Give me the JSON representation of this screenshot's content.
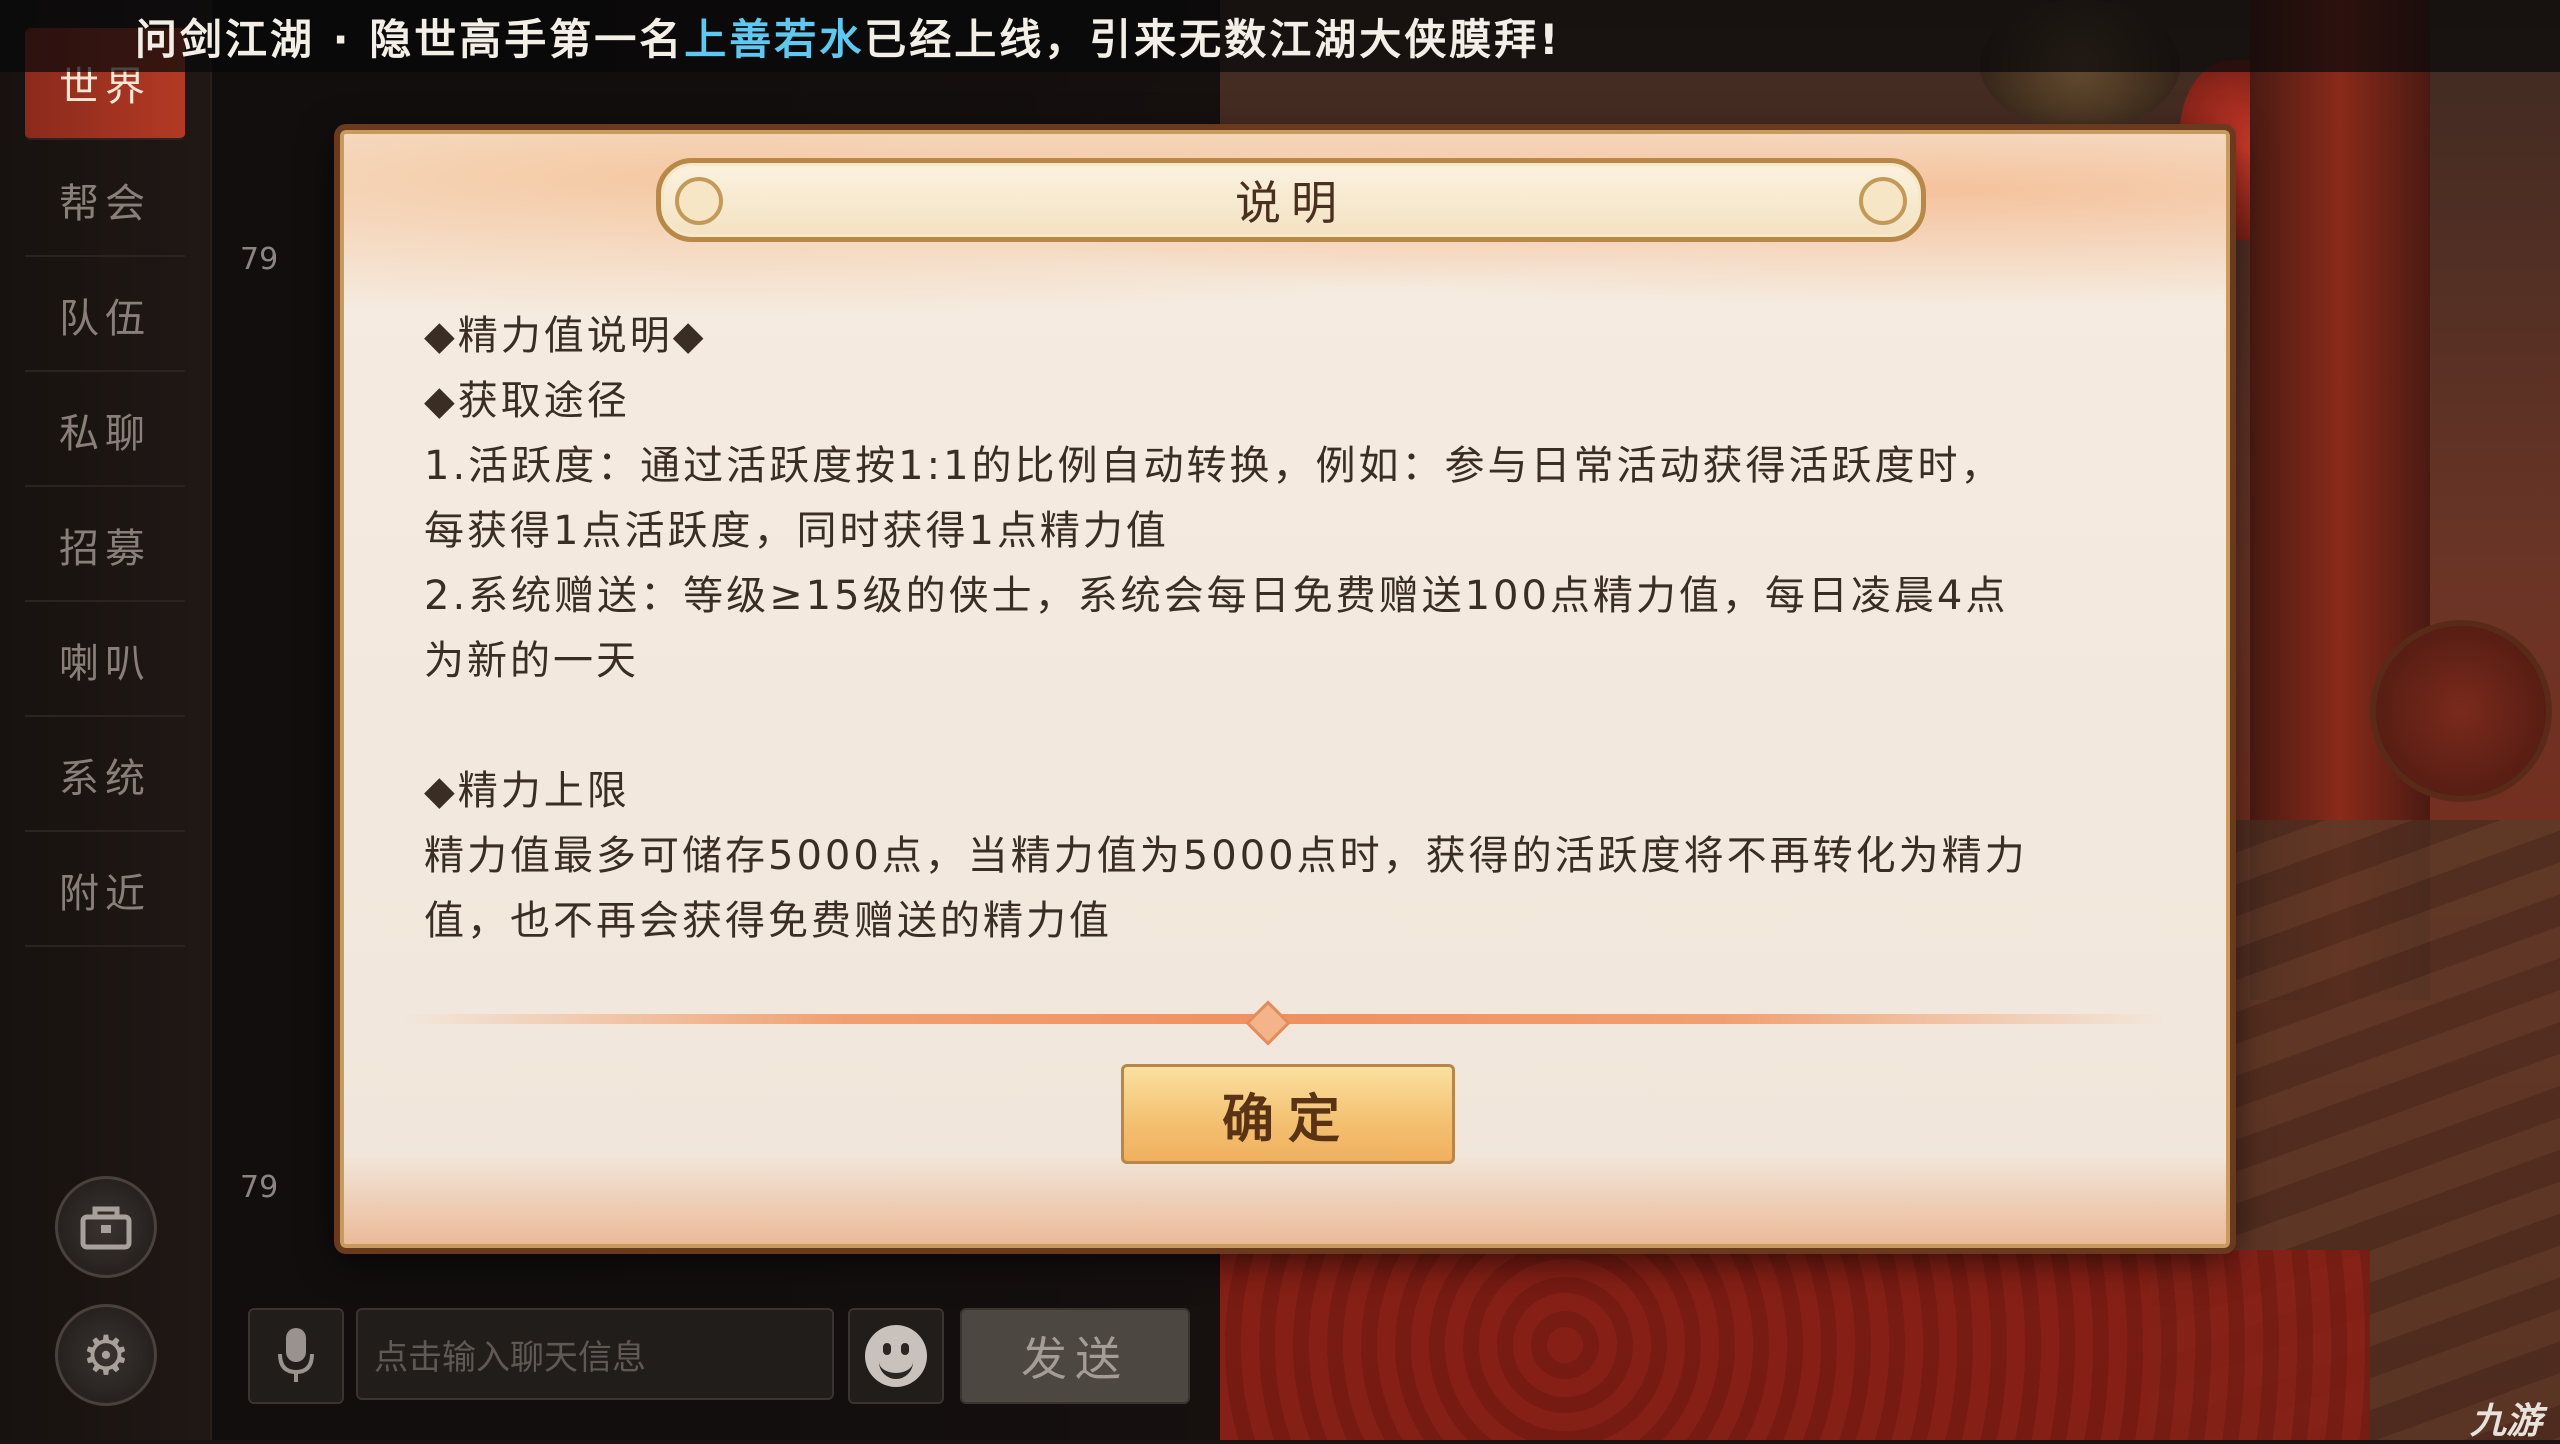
{
  "marquee": {
    "prefix": "问剑江湖 · 隐世高手第一名",
    "highlight": "上善若水",
    "suffix": "已经上线，引来无数江湖大侠膜拜!"
  },
  "chat": {
    "tabs": [
      "世界",
      "帮会",
      "队伍",
      "私聊",
      "招募",
      "喇叭",
      "系统",
      "附近"
    ],
    "levels": [
      "79",
      "79"
    ],
    "input_placeholder": "点击输入聊天信息",
    "send_label": "发送"
  },
  "dialog": {
    "title": "说明",
    "lines": {
      "l1": "◆精力值说明◆",
      "l2": "◆获取途径",
      "l3": "1.活跃度：通过活跃度按1:1的比例自动转换，例如：参与日常活动获得活跃度时，",
      "l4": "每获得1点活跃度，同时获得1点精力值",
      "l5": "2.系统赠送：等级≥15级的侠士，系统会每日免费赠送100点精力值，每日凌晨4点",
      "l6": "为新的一天",
      "l7": "◆精力上限",
      "l8": "精力值最多可储存5000点，当精力值为5000点时，获得的活跃度将不再转化为精力",
      "l9": "值，也不再会获得免费赠送的精力值"
    },
    "confirm_label": "确定"
  },
  "watermark": "九游",
  "colors": {
    "highlight": "#5ec8f0",
    "active_tab": "#b33a24",
    "dialog_bg": "#f3e9df",
    "button": "#f3c070"
  },
  "icons": {
    "mic": "microphone-icon",
    "emoji": "smiley-icon",
    "settings": "gear-icon",
    "bag": "bag-icon"
  }
}
